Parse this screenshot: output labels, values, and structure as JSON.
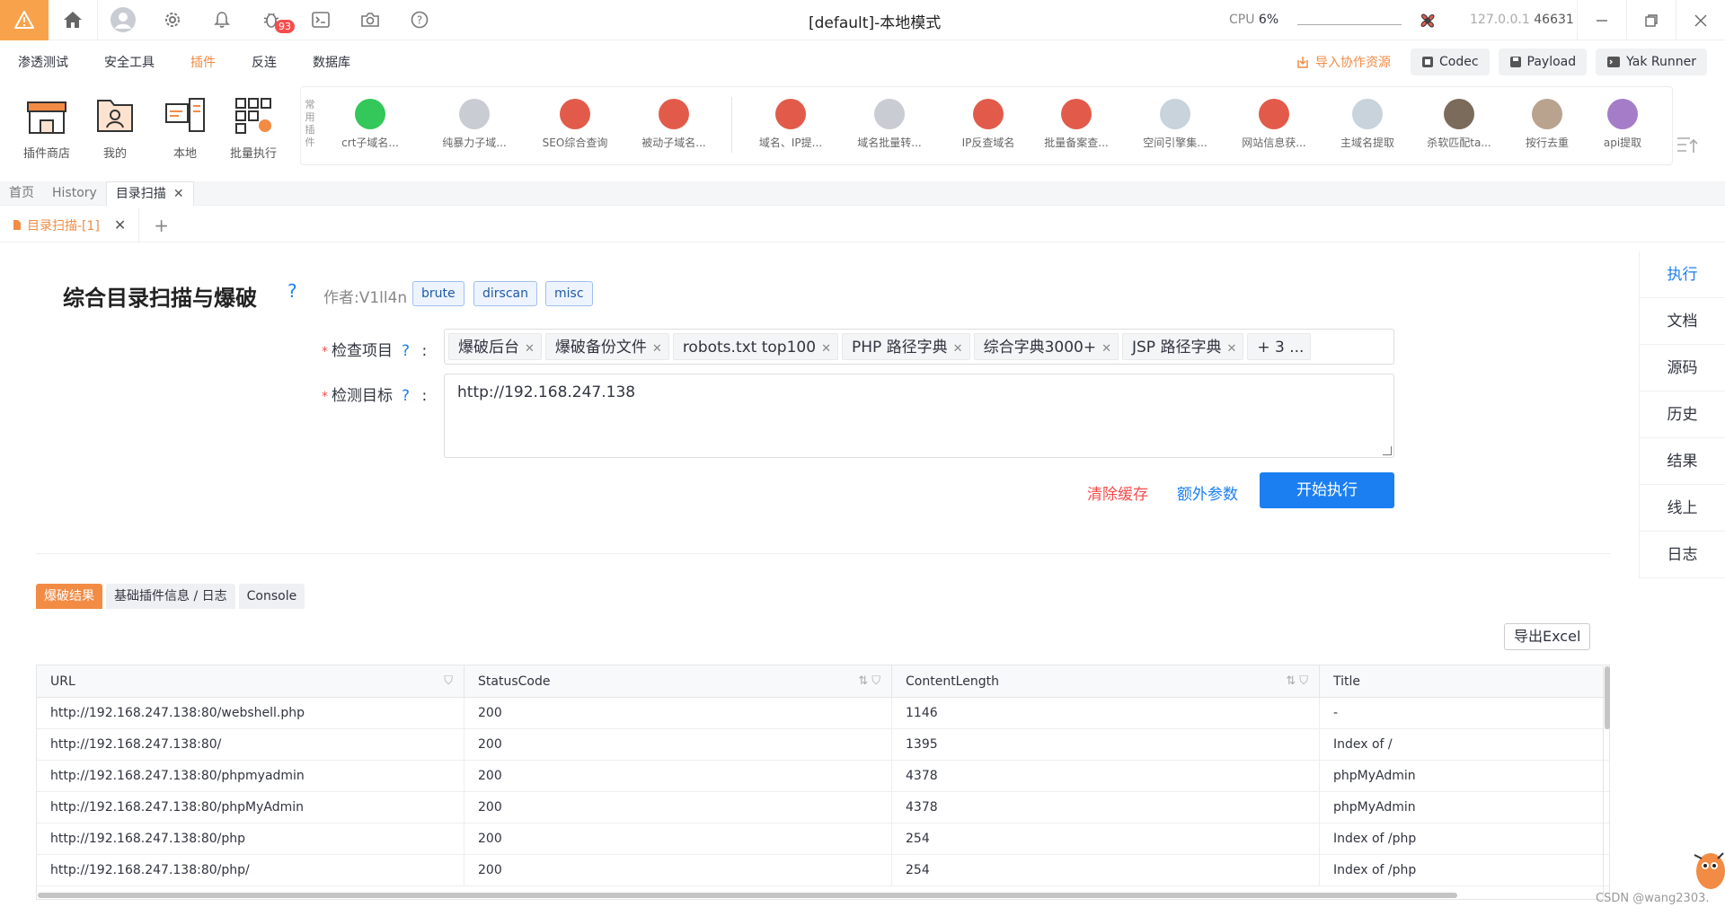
{
  "titlebar": {
    "app_title": "[default]-本地模式",
    "cpu_label": "CPU",
    "cpu_value": "6%",
    "host": "127.0.0.1",
    "port": "46631",
    "badge_count": "93"
  },
  "menu": {
    "items": [
      "渗透测试",
      "安全工具",
      "插件",
      "反连",
      "数据库"
    ],
    "active_index": 2,
    "import_label": "导入协作资源",
    "codec_label": "Codec",
    "payload_label": "Payload",
    "runner_label": "Yak Runner"
  },
  "toolbar": {
    "tools": [
      "插件商店",
      "我的",
      "本地",
      "批量执行"
    ],
    "common_label": "常用插件",
    "plugins": [
      "crt子域名...",
      "纯暴力子域...",
      "SEO综合查询",
      "被动子域名...",
      "域名、IP提...",
      "域名批量转...",
      "IP反查域名",
      "批量备案查...",
      "空间引擎集...",
      "网站信息获...",
      "主域名提取",
      "杀软匹配ta...",
      "按行去重",
      "api提取"
    ]
  },
  "route_tabs": [
    "首页",
    "History",
    "目录扫描"
  ],
  "sub_tab": "目录扫描-[1]",
  "plugin": {
    "title": "综合目录扫描与爆破",
    "help": "?",
    "author": "作者:V1ll4n",
    "tags": [
      "brute",
      "dirscan",
      "misc"
    ]
  },
  "form": {
    "items_label": "检查项目",
    "target_label": "检测目标",
    "colon": ":",
    "selected_items": [
      "爆破后台",
      "爆破备份文件",
      "robots.txt top100",
      "PHP 路径字典",
      "综合字典3000+",
      "JSP 路径字典"
    ],
    "more": "+ 3 ...",
    "target_value": "http://192.168.247.138",
    "clear_label": "清除缓存",
    "extra_label": "额外参数",
    "run_label": "开始执行"
  },
  "side_tabs": [
    "执行",
    "文档",
    "源码",
    "历史",
    "结果",
    "线上",
    "日志"
  ],
  "result_tabs": [
    "爆破结果",
    "基础插件信息 / 日志",
    "Console"
  ],
  "export_label": "导出Excel",
  "table": {
    "columns": [
      "URL",
      "StatusCode",
      "ContentLength",
      "Title"
    ],
    "rows": [
      [
        "http://192.168.247.138:80/webshell.php",
        "200",
        "1146",
        "-"
      ],
      [
        "http://192.168.247.138:80/",
        "200",
        "1395",
        "Index of /"
      ],
      [
        "http://192.168.247.138:80/phpmyadmin",
        "200",
        "4378",
        "phpMyAdmin"
      ],
      [
        "http://192.168.247.138:80/phpMyAdmin",
        "200",
        "4378",
        "phpMyAdmin"
      ],
      [
        "http://192.168.247.138:80/php",
        "200",
        "254",
        "Index of /php"
      ],
      [
        "http://192.168.247.138:80/php/",
        "200",
        "254",
        "Index of /php"
      ]
    ]
  },
  "watermark": "CSDN @wang2303.",
  "colors": {
    "accent": "#f28b44",
    "primary": "#1b7ff1",
    "danger": "#f54d4d"
  }
}
